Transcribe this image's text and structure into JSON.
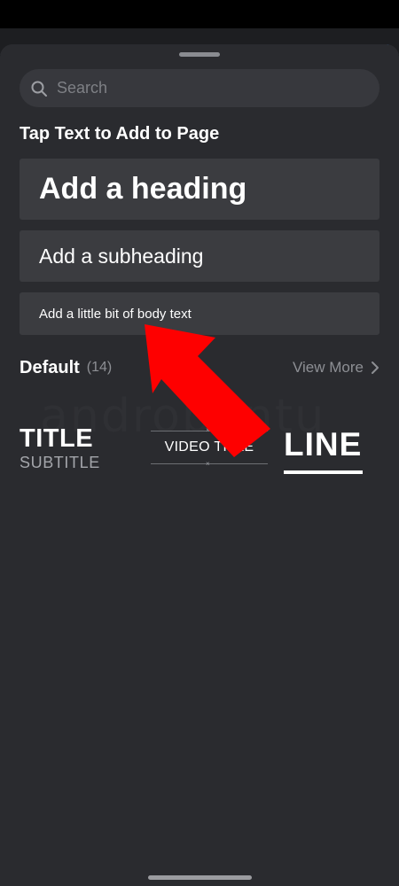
{
  "search": {
    "placeholder": "Search",
    "icon": "search-icon"
  },
  "section_title": "Tap Text to Add to Page",
  "text_options": [
    {
      "label": "Add a heading"
    },
    {
      "label": "Add a subheading"
    },
    {
      "label": "Add a little bit of body text"
    }
  ],
  "default_section": {
    "title": "Default",
    "count": "(14)",
    "view_more": "View More",
    "view_more_icon": "chevron-right-icon"
  },
  "styles": [
    {
      "title": "TITLE",
      "subtitle": "SUBTITLE"
    },
    {
      "title": "VIDEO TITLE",
      "mark": "×"
    },
    {
      "title": "LINE"
    }
  ],
  "watermark": "androbuntu",
  "colors": {
    "sheet_bg": "#2a2b2f",
    "card_bg": "#3b3c40",
    "search_bg": "#37383d",
    "muted_text": "#8d8f94",
    "annotation_arrow": "#fe0000"
  }
}
